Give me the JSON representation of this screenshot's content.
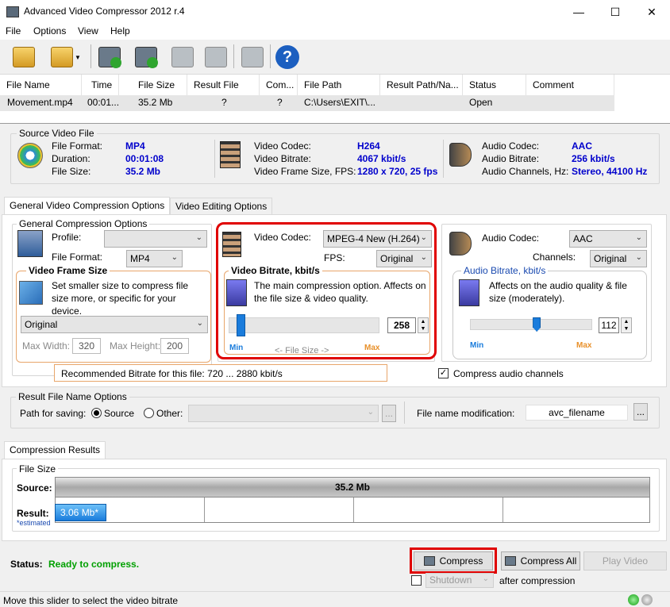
{
  "window": {
    "title": "Advanced Video Compressor 2012 r.4"
  },
  "menu": [
    "File",
    "Options",
    "View",
    "Help"
  ],
  "toolbar_icons": [
    "open-folder-icon",
    "open-folder-dropdown-icon",
    "start-compress-icon",
    "start-compress-all-icon",
    "pause-icon",
    "cancel-icon",
    "play-video-icon",
    "help-icon"
  ],
  "file_table": {
    "headers": [
      "File Name",
      "Time",
      "File Size",
      "Result File Size",
      "Com...",
      "File Path",
      "Result Path/Na...",
      "Status",
      "Comment"
    ],
    "rows": [
      [
        "Movement.mp4",
        "00:01...",
        "35.2 Mb",
        "?",
        "?",
        "C:\\Users\\EXIT\\...",
        "",
        "Open",
        ""
      ]
    ]
  },
  "source": {
    "title": "Source Video File",
    "file_format_label": "File Format:",
    "file_format": "MP4",
    "duration_label": "Duration:",
    "duration": "00:01:08",
    "file_size_label": "File Size:",
    "file_size": "35.2 Mb",
    "video_codec_label": "Video Codec:",
    "video_codec": "H264",
    "video_bitrate_label": "Video Bitrate:",
    "video_bitrate": "4067 kbit/s",
    "frame_label": "Video Frame Size, FPS:",
    "frame": "1280 x 720, 25 fps",
    "audio_codec_label": "Audio Codec:",
    "audio_codec": "AAC",
    "audio_bitrate_label": "Audio Bitrate:",
    "audio_bitrate": "256 kbit/s",
    "audio_channels_label": "Audio Channels, Hz:",
    "audio_channels": "Stereo, 44100 Hz"
  },
  "tabs": [
    "General Video Compression Options",
    "Video Editing Options"
  ],
  "general": {
    "title": "General Compression Options",
    "profile_label": "Profile:",
    "profile_value": "",
    "file_format_label": "File Format:",
    "file_format_value": "MP4",
    "frame_size_title": "Video Frame Size",
    "frame_size_desc": "Set smaller size to compress file size more, or specific for your device.",
    "frame_size_value": "Original",
    "max_width_label": "Max Width:",
    "max_width": "320",
    "max_height_label": "Max Height:",
    "max_height": "200"
  },
  "video": {
    "codec_label": "Video Codec:",
    "codec_value": "MPEG-4 New (H.264)",
    "fps_label": "FPS:",
    "fps_value": "Original",
    "bitrate_title": "Video Bitrate, kbit/s",
    "bitrate_desc": "The main compression option. Affects on the file size & video quality.",
    "bitrate_value": "258",
    "slider_fraction": 0.02,
    "min_label": "Min",
    "file_size_label": "<-  File Size  ->",
    "max_label": "Max"
  },
  "audio": {
    "codec_label": "Audio Codec:",
    "codec_value": "AAC",
    "channels_label": "Channels:",
    "channels_value": "Original",
    "bitrate_title": "Audio Bitrate, kbit/s",
    "bitrate_desc": "Affects on the audio quality & file size (moderately).",
    "bitrate_value": "112",
    "slider_fraction": 0.55,
    "min_label": "Min",
    "max_label": "Max",
    "compress_channels_label": "Compress audio channels",
    "compress_channels_checked": true
  },
  "recommended": "Recommended Bitrate for this file: 720 ... 2880 kbit/s",
  "result_name": {
    "title": "Result File Name Options",
    "path_label": "Path for saving:",
    "source_label": "Source",
    "other_label": "Other:",
    "browse_label": "...",
    "modification_label": "File name modification:",
    "modification_value": "avc_filename",
    "mod_browse_label": "..."
  },
  "results": {
    "tab": "Compression Results",
    "file_size_label": "File Size",
    "source_label": "Source:",
    "source_value": "35.2 Mb",
    "result_label": "Result:",
    "result_value": "3.06 Mb*",
    "estimated_label": "*estimated",
    "result_fraction": 0.087
  },
  "bottom": {
    "status_label": "Status:",
    "status_value": "Ready to compress.",
    "compress_label": "Compress",
    "compress_all_label": "Compress All",
    "play_label": "Play Video",
    "shutdown_value": "Shutdown",
    "after_label": "after compression",
    "statusbar": "Move this slider to select the video bitrate"
  },
  "colors": {
    "accent_blue": "#0000cc",
    "status_green": "#00a000",
    "highlight_red": "#e00000",
    "orange": "#e8a56a",
    "slider_blue": "#1a7cdc"
  }
}
